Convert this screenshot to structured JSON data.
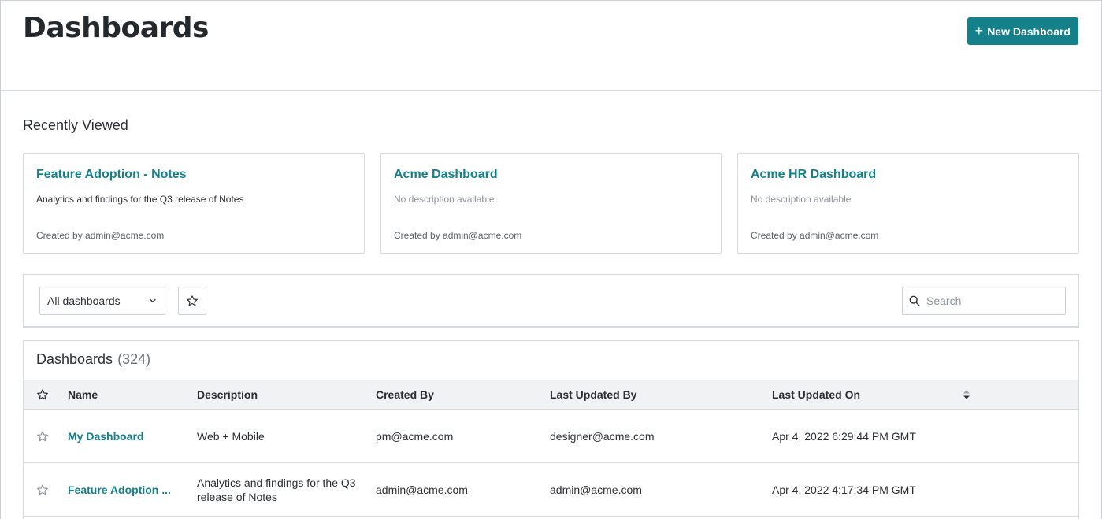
{
  "header": {
    "title": "Dashboards",
    "new_button_icon": "+",
    "new_button_label": "New Dashboard"
  },
  "recently_viewed": {
    "title": "Recently Viewed",
    "cards": [
      {
        "title": "Feature Adoption - Notes",
        "description": "Analytics and findings for the Q3 release of Notes",
        "created_by": "Created by admin@acme.com"
      },
      {
        "title": "Acme Dashboard",
        "description": "No description available",
        "created_by": "Created by admin@acme.com"
      },
      {
        "title": "Acme HR Dashboard",
        "description": "No description available",
        "created_by": "Created by admin@acme.com"
      }
    ]
  },
  "filters": {
    "select_value": "All dashboards",
    "search_placeholder": "Search"
  },
  "table": {
    "title": "Dashboards",
    "count": "(324)",
    "columns": [
      "Name",
      "Description",
      "Created By",
      "Last Updated By",
      "Last Updated On"
    ],
    "rows": [
      {
        "name": "My Dashboard",
        "description": "Web + Mobile",
        "created_by": "pm@acme.com",
        "last_updated_by": "designer@acme.com",
        "last_updated_on": "Apr 4, 2022 6:29:44 PM GMT"
      },
      {
        "name": "Feature Adoption ...",
        "description": "Analytics and findings for the Q3 release of Notes",
        "created_by": "admin@acme.com",
        "last_updated_by": "admin@acme.com",
        "last_updated_on": "Apr 4, 2022 4:17:34 PM GMT"
      }
    ]
  },
  "icons": {
    "add": "plus-icon",
    "dropdown": "chevron-down-icon",
    "favorite": "star-outline-icon",
    "search": "search-icon",
    "sort": "sort-icon"
  },
  "colors": {
    "accent": "#13808a",
    "border": "#d5dadf",
    "header_bg": "#f0f2f4",
    "text": "#2b2f33",
    "muted": "#8a9299"
  }
}
